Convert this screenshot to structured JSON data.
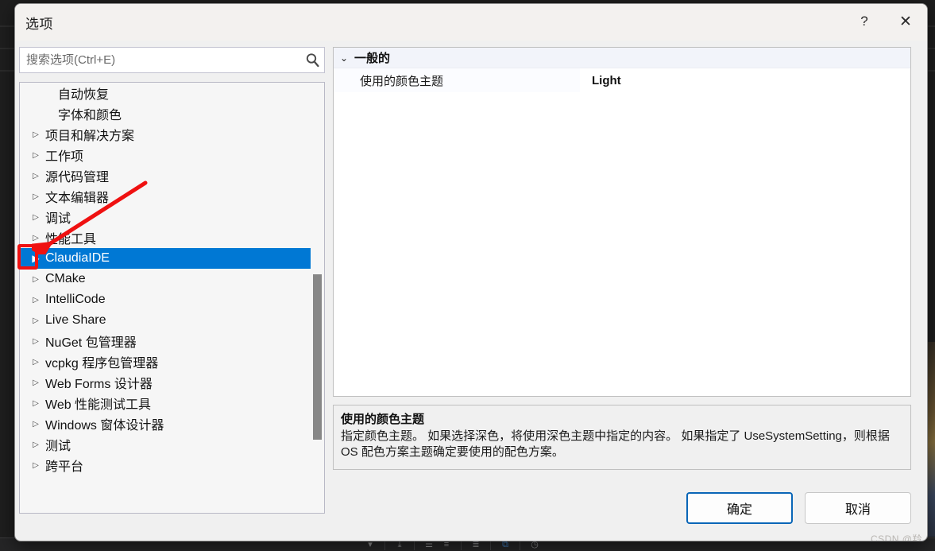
{
  "dialog": {
    "title": "选项",
    "caption_buttons": [
      {
        "name": "help-button",
        "glyph": "?"
      },
      {
        "name": "close-button",
        "glyph": "✕"
      }
    ]
  },
  "search": {
    "placeholder": "搜索选项(Ctrl+E)",
    "value": "",
    "icon": "search-icon"
  },
  "tree": {
    "items": [
      {
        "label": "自动恢复",
        "expandable": false,
        "selected": false
      },
      {
        "label": "字体和颜色",
        "expandable": false,
        "selected": false
      },
      {
        "label": "项目和解决方案",
        "expandable": true,
        "selected": false
      },
      {
        "label": "工作项",
        "expandable": true,
        "selected": false
      },
      {
        "label": "源代码管理",
        "expandable": true,
        "selected": false
      },
      {
        "label": "文本编辑器",
        "expandable": true,
        "selected": false
      },
      {
        "label": "调试",
        "expandable": true,
        "selected": false
      },
      {
        "label": "性能工具",
        "expandable": true,
        "selected": false
      },
      {
        "label": "ClaudiaIDE",
        "expandable": true,
        "selected": true
      },
      {
        "label": "CMake",
        "expandable": true,
        "selected": false
      },
      {
        "label": "IntelliCode",
        "expandable": true,
        "selected": false
      },
      {
        "label": "Live Share",
        "expandable": true,
        "selected": false
      },
      {
        "label": "NuGet 包管理器",
        "expandable": true,
        "selected": false
      },
      {
        "label": "vcpkg 程序包管理器",
        "expandable": true,
        "selected": false
      },
      {
        "label": "Web Forms 设计器",
        "expandable": true,
        "selected": false
      },
      {
        "label": "Web 性能测试工具",
        "expandable": true,
        "selected": false
      },
      {
        "label": "Windows 窗体设计器",
        "expandable": true,
        "selected": false
      },
      {
        "label": "测试",
        "expandable": true,
        "selected": false
      },
      {
        "label": "跨平台",
        "expandable": true,
        "selected": false
      }
    ],
    "collapsed_glyph": "▷",
    "expanded_selected_glyph": "▶",
    "selection_color": "#0078d4"
  },
  "property_grid": {
    "category": "一般的",
    "category_chevron": "⌄",
    "rows": [
      {
        "name": "使用的颜色主题",
        "value": "Light"
      }
    ]
  },
  "description": {
    "title": "使用的颜色主题",
    "text": "指定颜色主题。 如果选择深色，将使用深色主题中指定的内容。 如果指定了 UseSystemSetting，则根据 OS 配色方案主题确定要使用的配色方案。"
  },
  "footer": {
    "ok_label": "确定",
    "cancel_label": "取消"
  },
  "watermark": {
    "text": "CSDN @羚"
  },
  "annotations": {
    "highlight_color": "#ef1111"
  }
}
